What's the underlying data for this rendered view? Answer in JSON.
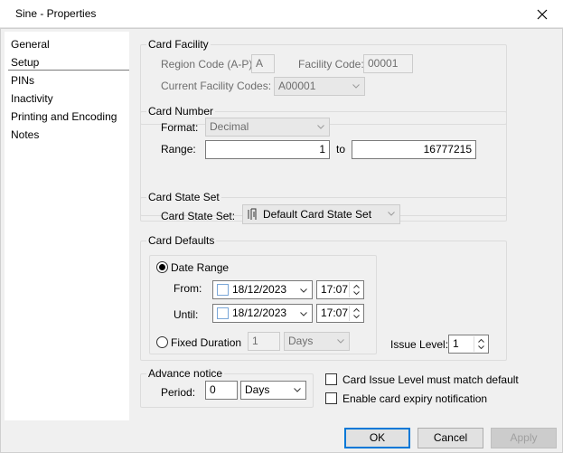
{
  "window": {
    "title": "Sine - Properties"
  },
  "sidebar": {
    "items": [
      {
        "label": "General"
      },
      {
        "label": "Setup"
      },
      {
        "label": "PINs"
      },
      {
        "label": "Inactivity"
      },
      {
        "label": "Printing and Encoding"
      },
      {
        "label": "Notes"
      }
    ]
  },
  "card_facility": {
    "group_label": "Card Facility",
    "region_code_label": "Region Code (A-P):",
    "region_code_value": "A",
    "facility_code_label": "Facility Code:",
    "facility_code_value": "00001",
    "current_codes_label": "Current Facility Codes:",
    "current_codes_value": "A00001"
  },
  "card_number": {
    "group_label": "Card Number",
    "format_label": "Format:",
    "format_value": "Decimal",
    "range_label": "Range:",
    "range_from": "1",
    "to_label": "to",
    "range_to": "16777215"
  },
  "card_state_set": {
    "group_label": "Card State Set",
    "label": "Card State Set:",
    "value": "Default Card State Set"
  },
  "card_defaults": {
    "group_label": "Card Defaults",
    "date_range_label": "Date Range",
    "from_label": "From:",
    "from_date": "18/12/2023",
    "from_time": "17:07",
    "until_label": "Until:",
    "until_date": "18/12/2023",
    "until_time": "17:07",
    "fixed_duration_label": "Fixed Duration",
    "duration_value": "1",
    "duration_unit": "Days",
    "issue_level_label": "Issue Level:",
    "issue_level_value": "1"
  },
  "advance_notice": {
    "group_label": "Advance notice",
    "period_label": "Period:",
    "period_value": "0",
    "period_unit": "Days"
  },
  "checks": {
    "issue_level_match": "Card Issue Level must match default",
    "expiry_notification": "Enable card expiry notification"
  },
  "buttons": {
    "ok": "OK",
    "cancel": "Cancel",
    "apply": "Apply"
  }
}
